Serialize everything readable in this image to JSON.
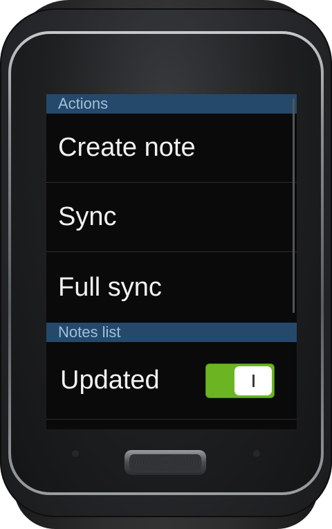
{
  "screen": {
    "sections": [
      {
        "header": "Actions",
        "items": [
          "Create note",
          "Sync",
          "Full sync"
        ]
      },
      {
        "header": "Notes list",
        "toggle": {
          "label": "Updated",
          "state": "on"
        }
      }
    ]
  },
  "colors": {
    "section_header_bg": "#25496a",
    "section_header_text": "#9fc0dc",
    "toggle_on": "#6cb522"
  },
  "icons": {
    "home_button": "home-button-icon"
  }
}
